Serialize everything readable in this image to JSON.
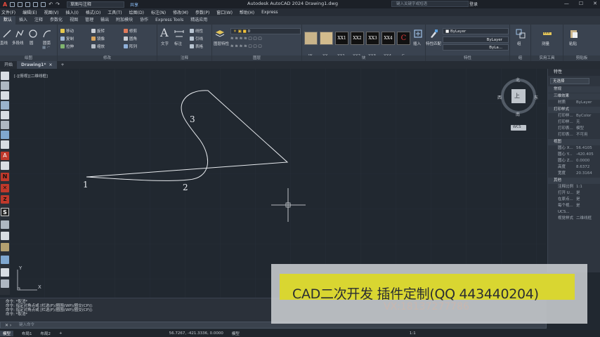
{
  "titlebar": {
    "workspace": "草图与注释",
    "share": "共享",
    "app_title": "Autodesk AutoCAD 2024    Drawing1.dwg",
    "search_placeholder": "键入关键字或短语",
    "login": "登录",
    "window_buttons": [
      "—",
      "☐",
      "✕"
    ]
  },
  "menu": [
    "文件(F)",
    "编辑(E)",
    "视图(V)",
    "插入(I)",
    "格式(O)",
    "工具(T)",
    "绘图(D)",
    "标注(N)",
    "修改(M)",
    "参数(P)",
    "窗口(W)",
    "帮助(H)",
    "Express"
  ],
  "ribbon_tabs": [
    {
      "label": "默认",
      "active": true
    },
    {
      "label": "插入",
      "active": false
    },
    {
      "label": "注释",
      "active": false
    },
    {
      "label": "参数化",
      "active": false
    },
    {
      "label": "视图",
      "active": false
    },
    {
      "label": "管理",
      "active": false
    },
    {
      "label": "输出",
      "active": false
    },
    {
      "label": "附加模块",
      "active": false
    },
    {
      "label": "协作",
      "active": false
    },
    {
      "label": "Express Tools",
      "active": false
    },
    {
      "label": "精选应用",
      "active": false
    }
  ],
  "ribbon": {
    "draw": {
      "title": "绘图",
      "tools": [
        "直线",
        "多段线",
        "圆",
        "圆弧"
      ]
    },
    "modify": {
      "title": "修改",
      "tools": [
        "移动",
        "旋转",
        "修剪",
        "复制",
        "镜像",
        "圆角",
        "拉伸",
        "缩放",
        "阵列"
      ]
    },
    "annotation": {
      "title": "注释",
      "tools": [
        "文字",
        "标注",
        "线性",
        "引线",
        "表格"
      ]
    },
    "layers": {
      "title": "图层",
      "tools": [
        "图层特性"
      ],
      "current_layer": "0"
    },
    "block": {
      "title": "块",
      "items": [
        "W",
        "XX",
        "XX1",
        "XX2",
        "XX3",
        "XX4",
        "C"
      ],
      "insert": "插入"
    },
    "properties": {
      "title": "特性",
      "color": "ByLayer",
      "linetype": "ByLayer",
      "lineweight": "ByLa...",
      "match": "特性匹配"
    },
    "groups": {
      "title": "组",
      "label": "组"
    },
    "utilities": {
      "title": "实用工具",
      "label": "测量"
    },
    "clipboard": {
      "title": "剪贴板",
      "label": "粘贴"
    }
  },
  "doc_tabs": [
    {
      "label": "开始",
      "active": false
    },
    {
      "label": "Drawing1*",
      "active": true
    }
  ],
  "viewport_label": "[-][俯视][二维线框]",
  "drawing": {
    "labels": [
      "1",
      "2",
      "3"
    ],
    "ucs_x": "X",
    "ucs_y": "Y"
  },
  "viewcube": {
    "north": "北",
    "south": "南",
    "west": "西",
    "east": "东",
    "face": "上",
    "wcs": "WCS"
  },
  "properties": {
    "title": "特性",
    "selection": "无选择",
    "sections": [
      {
        "name": "常规",
        "rows": []
      },
      {
        "name": "三维效果",
        "rows": [
          {
            "k": "材质",
            "v": "ByLayer"
          }
        ]
      },
      {
        "name": "打印样式",
        "rows": [
          {
            "k": "打印样...",
            "v": "ByColor"
          },
          {
            "k": "打印样...",
            "v": "无"
          },
          {
            "k": "打印表...",
            "v": "模型"
          },
          {
            "k": "打印表...",
            "v": "不可用"
          }
        ]
      },
      {
        "name": "视图",
        "rows": [
          {
            "k": "圆心 X...",
            "v": "56.4105"
          },
          {
            "k": "圆心 Y...",
            "v": "-420.405"
          },
          {
            "k": "圆心 Z...",
            "v": "0.0000"
          },
          {
            "k": "高度",
            "v": "8.6372"
          },
          {
            "k": "宽度",
            "v": "20.3164"
          }
        ]
      },
      {
        "name": "其他",
        "rows": [
          {
            "k": "注释比例",
            "v": "1:1"
          },
          {
            "k": "打开 U...",
            "v": "是"
          },
          {
            "k": "在原点...",
            "v": "是"
          },
          {
            "k": "每个视...",
            "v": "是"
          },
          {
            "k": "UCS...",
            "v": ""
          },
          {
            "k": "视觉样式",
            "v": "二维线框"
          }
        ]
      }
    ]
  },
  "command_history": [
    "命令: *取消*",
    "命令: 指定对角点或 [栏选(F)/圈围(WP)/圈交(CP)]:",
    "命令: 指定对角点或 [栏选(F)/圈围(WP)/圈交(CP)]:",
    "命令: *取消*"
  ],
  "command_placeholder": "键入命令",
  "statusbar": {
    "tabs": [
      "模型",
      "布局1",
      "布局2"
    ],
    "coords": "56.7267, -421.3336, 0.0000",
    "mode": "模型",
    "scale": "1:1"
  },
  "overlay": {
    "line1": "CAD二次开发 插件定制(QQ 443440204)",
    "line2": "VX:18137277786"
  }
}
